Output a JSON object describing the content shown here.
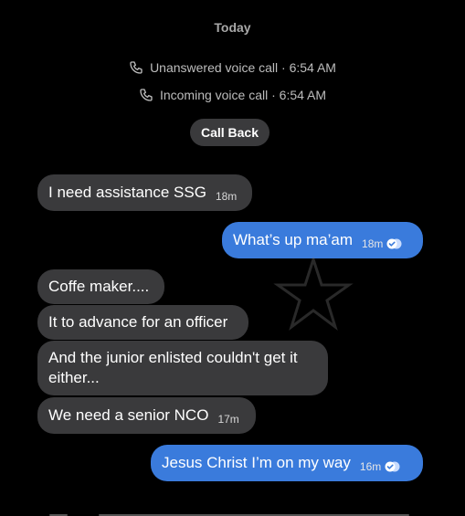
{
  "header": {
    "date": "Today"
  },
  "call_events": [
    {
      "text": "Unanswered voice call · 6:54 AM",
      "icon": "phone-icon"
    },
    {
      "text": "Incoming voice call · 6:54 AM",
      "icon": "phone-icon"
    }
  ],
  "call_back_label": "Call Back",
  "messages": [
    {
      "direction": "incoming",
      "text": "I need assistance SSG",
      "time": "18m"
    },
    {
      "direction": "outgoing",
      "text": "What’s up ma’am",
      "time": "18m",
      "status": "read"
    },
    {
      "direction": "incoming",
      "text": "Coffe maker...."
    },
    {
      "direction": "incoming",
      "text": "It to advance for an officer"
    },
    {
      "direction": "incoming",
      "text": "And the junior enlisted couldn't get it either..."
    },
    {
      "direction": "incoming",
      "text": "We need a senior NCO",
      "time": "17m"
    },
    {
      "direction": "outgoing",
      "text": "Jesus Christ I’m on my way",
      "time": "16m",
      "status": "read"
    }
  ],
  "colors": {
    "background": "#000000",
    "incoming_bubble": "#3a3a3c",
    "outgoing_bubble": "#3a7bdc"
  }
}
